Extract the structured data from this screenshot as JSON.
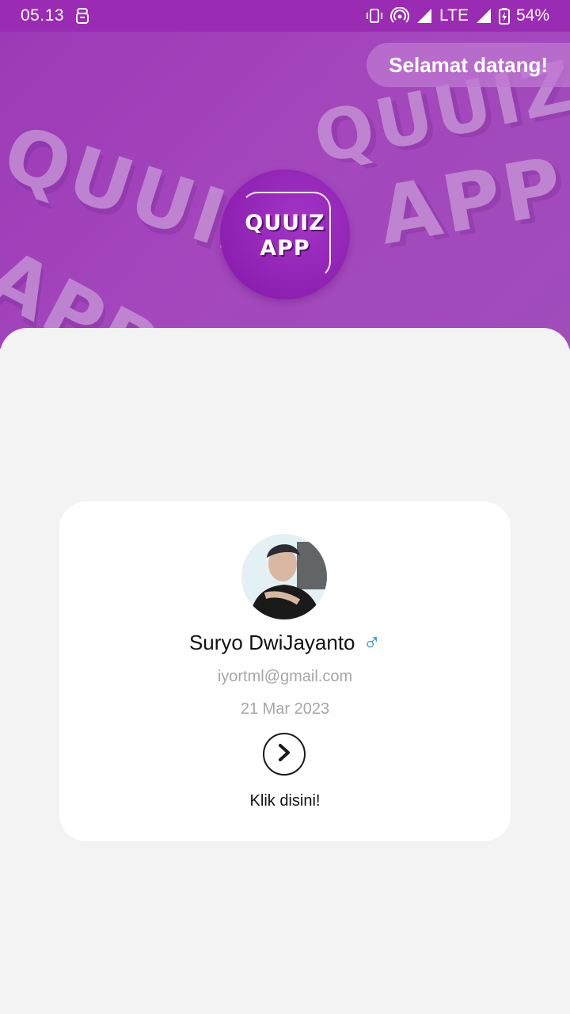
{
  "status_bar": {
    "time": "05.13",
    "network": "LTE",
    "battery": "54%"
  },
  "header": {
    "welcome_label": "Selamat datang!",
    "logo_line1": "QUUIZ",
    "logo_line2": "APP",
    "bg_words": [
      "QUUIZ",
      "APP",
      "QUUIZ",
      "APP"
    ]
  },
  "profile": {
    "name": "Suryo DwiJayanto",
    "gender_symbol": "♂",
    "email": "iyortml@gmail.com",
    "date": "21 Mar 2023",
    "action_label": "Klik disini!"
  },
  "colors": {
    "header": "#9b3ab6",
    "status_bar": "#9a2bb3",
    "gender": "#1e88e5",
    "sheet": "#f3f3f3"
  },
  "icons": {
    "gender": "male-icon",
    "action": "chevron-right-circle-icon"
  }
}
